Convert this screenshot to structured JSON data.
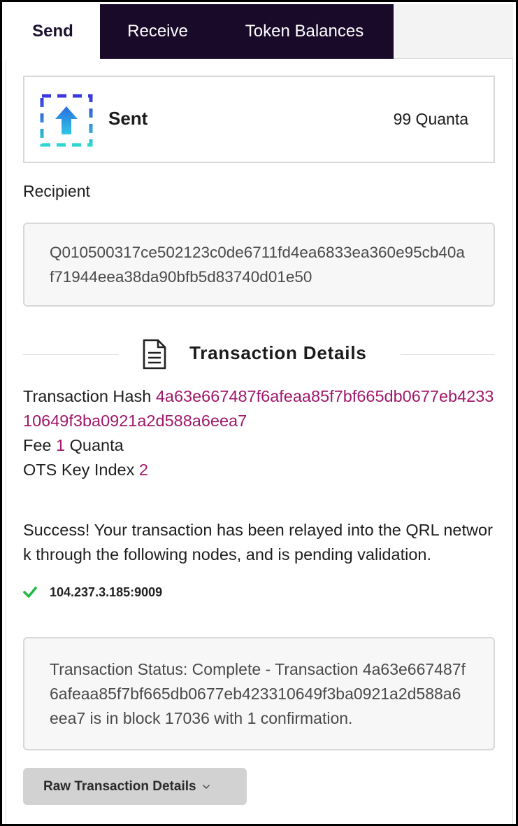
{
  "tabs": [
    {
      "label": "Send",
      "active": true
    },
    {
      "label": "Receive",
      "active": false
    },
    {
      "label": "Token Balances",
      "active": false
    }
  ],
  "sent": {
    "title": "Sent",
    "amount": "99 Quanta",
    "icon": "upload-arrow-icon"
  },
  "recipient": {
    "label": "Recipient",
    "address": "Q010500317ce502123c0de6711fd4ea6833ea360e95cb40af71944eea38da90bfb5d83740d01e50"
  },
  "details": {
    "heading": "Transaction Details",
    "hash_label": "Transaction Hash",
    "hash": "4a63e667487f6afeaa85f7bf665db0677eb423310649f3ba0921a2d588a6eea7",
    "fee_label": "Fee",
    "fee_value": "1",
    "fee_unit": "Quanta",
    "ots_label": "OTS Key Index",
    "ots_value": "2"
  },
  "success_message": "Success! Your transaction has been relayed into the QRL network through the following nodes, and is pending validation.",
  "nodes": [
    "104.237.3.185:9009"
  ],
  "status": "Transaction Status: Complete - Transaction 4a63e667487f6afeaa85f7bf665db0677eb423310649f3ba0921a2d588a6eea7 is in block 17036 with 1 confirmation.",
  "raw_button_label": "Raw Transaction Details",
  "colors": {
    "tab_dark": "#190a2a",
    "highlight": "#a0186a",
    "check": "#21ba45"
  }
}
